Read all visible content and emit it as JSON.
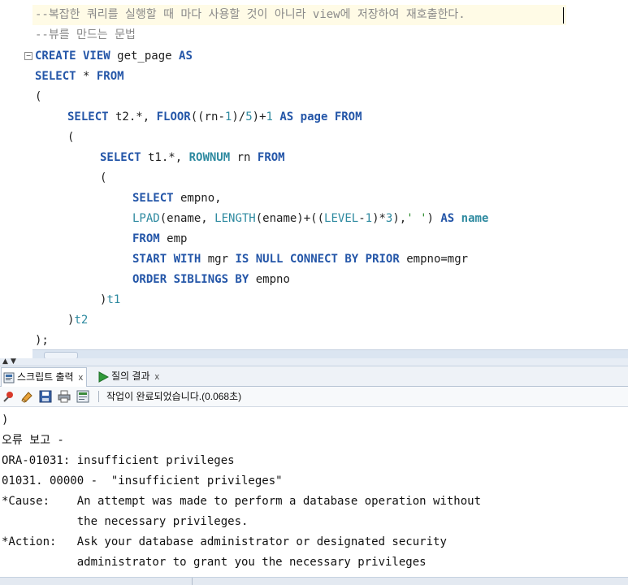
{
  "editor": {
    "comment1": "--복잡한 쿼리를 실행할 때 마다 사용할 것이 아니라 view에 저장하여 재호출한다.",
    "comment2": "--뷰를 만드는 문법",
    "line_create": [
      "CREATE VIEW",
      " get_page ",
      "AS"
    ],
    "line_select": [
      "SELECT",
      " * ",
      "FROM"
    ],
    "line_open1": "(",
    "line_select2": [
      "SELECT",
      " t2.*, ",
      "FLOOR",
      "((rn-",
      "1",
      ")/",
      "5",
      ")+",
      "1",
      " ",
      "AS",
      " ",
      "page",
      " ",
      "FROM"
    ],
    "line_open2": "(",
    "line_select3": [
      "SELECT",
      " t1.*, ",
      "ROWNUM",
      " rn ",
      "FROM"
    ],
    "line_open3": "(",
    "line_select4": [
      "SELECT",
      " empno,"
    ],
    "line_lpad": [
      "LPAD",
      "(ename, ",
      "LENGTH",
      "(ename)+((",
      "LEVEL",
      "-",
      "1",
      ")*",
      "3",
      "),",
      "' '",
      ") ",
      "AS",
      " ",
      "name"
    ],
    "line_from": [
      "FROM",
      " emp"
    ],
    "line_start": [
      "START WITH",
      " mgr ",
      "IS NULL",
      " ",
      "CONNECT BY",
      " ",
      "PRIOR",
      " empno=mgr"
    ],
    "line_order": [
      "ORDER SIBLINGS BY",
      " empno"
    ],
    "line_t1": [
      ")",
      "t1"
    ],
    "line_t2": [
      ")",
      "t2"
    ],
    "line_end": ");"
  },
  "tabs": {
    "script_output": "스크립트 출력",
    "query_result": "질의 결과",
    "close": "x"
  },
  "toolbar": {
    "status": "작업이 완료되었습니다.(0.068초)"
  },
  "output": {
    "lines": [
      ")",
      "오류 보고 -",
      "ORA-01031: insufficient privileges",
      "01031. 00000 -  \"insufficient privileges\"",
      "*Cause:    An attempt was made to perform a database operation without",
      "           the necessary privileges.",
      "*Action:   Ask your database administrator or designated security",
      "           administrator to grant you the necessary privileges"
    ]
  },
  "colors": {
    "keyword": "#2456a8",
    "function": "#2e8aa0",
    "comment": "#8a8a8a",
    "string": "#2a8a2a"
  },
  "icons": [
    "pin-icon",
    "eraser-icon",
    "save-icon",
    "print-icon",
    "export-icon",
    "script-icon",
    "run-icon"
  ]
}
